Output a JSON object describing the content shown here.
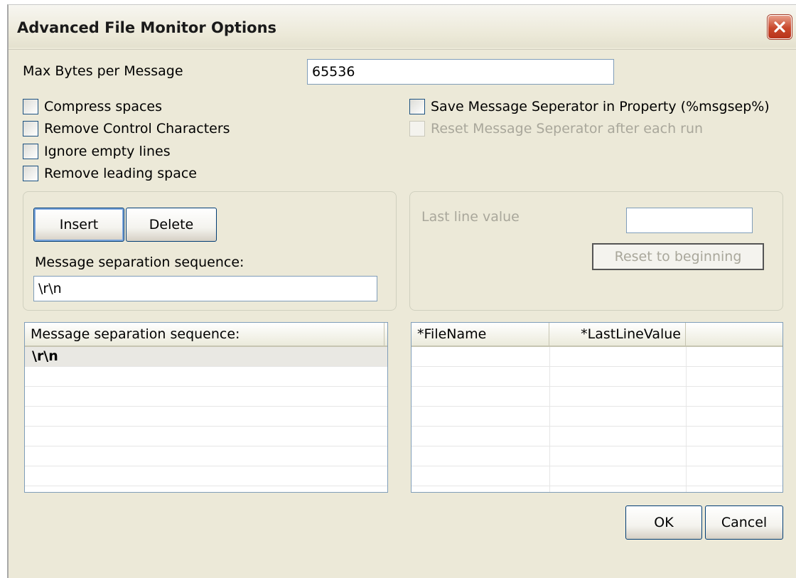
{
  "window": {
    "title": "Advanced File Monitor Options"
  },
  "max_bytes": {
    "label": "Max Bytes per Message",
    "value": "65536"
  },
  "options": {
    "compress_spaces": "Compress spaces",
    "remove_control_chars": "Remove Control Characters",
    "ignore_empty_lines": "Ignore empty lines",
    "remove_leading_space": "Remove leading space",
    "save_separator": "Save Message Seperator in Property (%msgsep%)",
    "reset_separator": "Reset Message Seperator after each run"
  },
  "separator_group": {
    "insert_label": "Insert",
    "delete_label": "Delete",
    "sequence_label": "Message separation sequence:",
    "sequence_value": "\\r\\n"
  },
  "last_line_group": {
    "label": "Last line value",
    "value": "",
    "reset_label": "Reset to beginning"
  },
  "sequence_list": {
    "header": "Message separation sequence:",
    "rows": [
      "\\r\\n"
    ]
  },
  "file_list": {
    "columns": [
      "*FileName",
      "*LastLineValue"
    ]
  },
  "footer": {
    "ok_label": "OK",
    "cancel_label": "Cancel"
  }
}
